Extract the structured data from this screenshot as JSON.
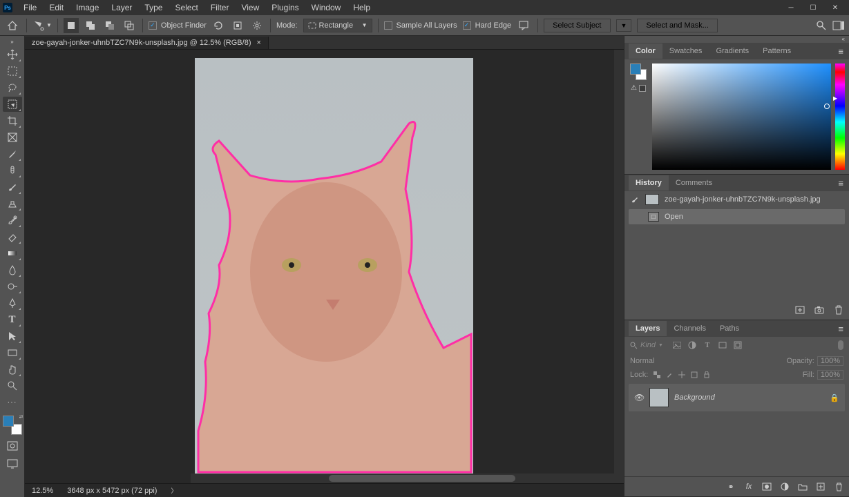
{
  "menu": {
    "file": "File",
    "edit": "Edit",
    "image": "Image",
    "layer": "Layer",
    "type": "Type",
    "select": "Select",
    "filter": "Filter",
    "view": "View",
    "plugins": "Plugins",
    "window": "Window",
    "help": "Help"
  },
  "optionsbar": {
    "object_finder": "Object Finder",
    "mode_label": "Mode:",
    "mode_value": "Rectangle",
    "sample_all": "Sample All Layers",
    "hard_edge": "Hard Edge",
    "select_subject": "Select Subject",
    "select_and_mask": "Select and Mask..."
  },
  "document": {
    "tab_title": "zoe-gayah-jonker-uhnbTZC7N9k-unsplash.jpg @ 12.5% (RGB/8)",
    "zoom": "12.5%",
    "dimensions": "3648 px x 5472 px (72 ppi)"
  },
  "panels": {
    "color": {
      "tabs": [
        "Color",
        "Swatches",
        "Gradients",
        "Patterns"
      ]
    },
    "history": {
      "tabs": [
        "History",
        "Comments"
      ],
      "doc_name": "zoe-gayah-jonker-uhnbTZC7N9k-unsplash.jpg",
      "items": [
        "Open"
      ]
    },
    "layers": {
      "tabs": [
        "Layers",
        "Channels",
        "Paths"
      ],
      "kind_placeholder": "Kind",
      "blend_mode": "Normal",
      "opacity_label": "Opacity:",
      "opacity_value": "100%",
      "lock_label": "Lock:",
      "fill_label": "Fill:",
      "fill_value": "100%",
      "layer_name": "Background"
    }
  }
}
